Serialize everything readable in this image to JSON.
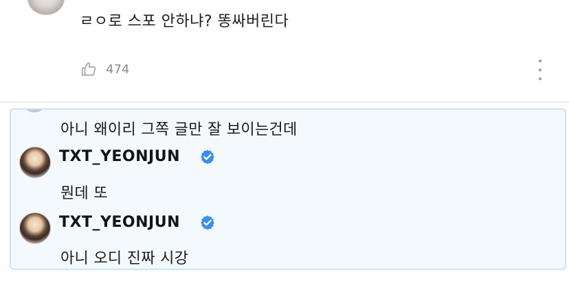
{
  "comment": {
    "text": "ㄹㅇ로 스포 안하냐? 똥싸버린다",
    "like_count": "474",
    "icons": {
      "like": "thumbs-up-icon",
      "more": "more-vertical-icon"
    }
  },
  "replies": [
    {
      "author": "",
      "text": "아니 왜이리 그쪽 글만 잘 보이는건데"
    },
    {
      "author": "TXT_YEONJUN",
      "verified": true,
      "text": "뭔데 또"
    },
    {
      "author": "TXT_YEONJUN",
      "verified": true,
      "text": "아니 오디 진짜 시강"
    }
  ],
  "colors": {
    "reply_bg": "#f4f9fe",
    "reply_border": "#cfe2f6",
    "verified": "#3b8ef0",
    "muted": "#8a8a8a"
  }
}
